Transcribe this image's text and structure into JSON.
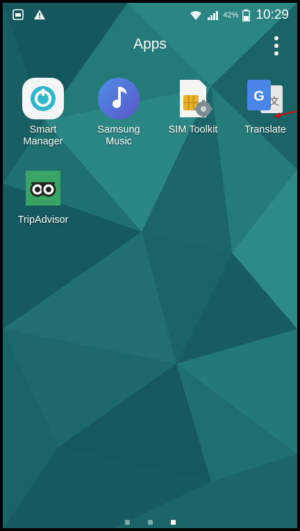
{
  "status_bar": {
    "battery_percent": "42%",
    "time": "10:29"
  },
  "header": {
    "title": "Apps"
  },
  "apps": [
    {
      "label": "Smart\nManager",
      "icon": "smart-manager-icon"
    },
    {
      "label": "Samsung\nMusic",
      "icon": "samsung-music-icon"
    },
    {
      "label": "SIM Toolkit",
      "icon": "sim-toolkit-icon"
    },
    {
      "label": "Translate",
      "icon": "google-translate-icon"
    },
    {
      "label": "TripAdvisor",
      "icon": "tripadvisor-icon"
    }
  ],
  "pager": {
    "pages": 3,
    "current_page": 3
  },
  "colors": {
    "wallpaper": "#1e6e6f",
    "annotation_arrow": "#cc1111"
  }
}
